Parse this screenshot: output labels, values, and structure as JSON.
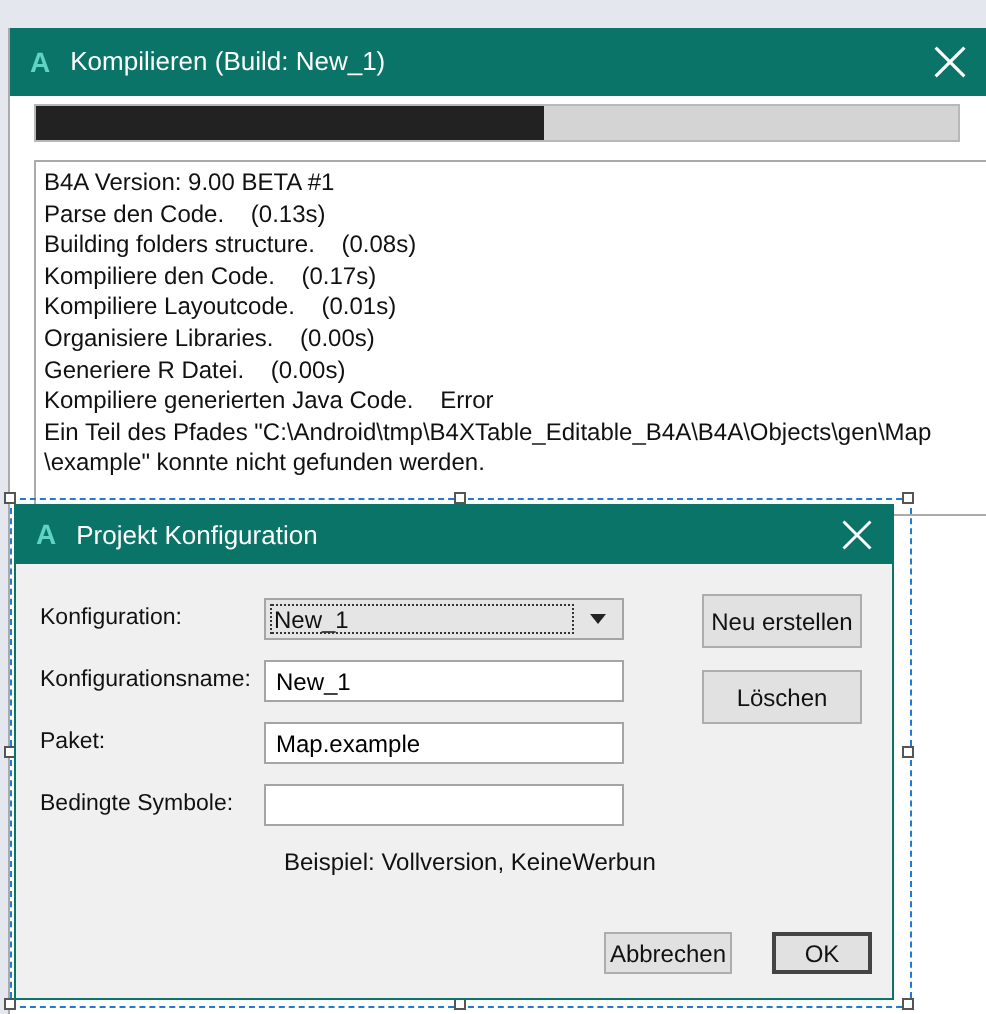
{
  "compile_window": {
    "app_mark": "A",
    "title": "Kompilieren (Build: New_1)",
    "progress": {
      "level": 0.55
    },
    "log": [
      "B4A Version: 9.00 BETA #1",
      "Parse den Code.    (0.13s)",
      "Building folders structure.    (0.08s)",
      "Kompiliere den Code.    (0.17s)",
      "Kompiliere Layoutcode.    (0.01s)",
      "Organisiere Libraries.    (0.00s)",
      "Generiere R Datei.    (0.00s)",
      "Kompiliere generierten Java Code.    Error",
      "Ein Teil des Pfades \"C:\\Android\\tmp\\B4XTable_Editable_B4A\\B4A\\Objects\\gen\\Map",
      "\\example\" konnte nicht gefunden werden."
    ]
  },
  "config_dialog": {
    "app_mark": "A",
    "title": "Projekt Konfiguration",
    "selected": true,
    "fields": [
      {
        "label": "Konfiguration:",
        "kind": "dropdown",
        "value": "New_1",
        "focused": true
      },
      {
        "label": "Konfigurationsname:",
        "kind": "text",
        "value": "New_1"
      },
      {
        "label": "Paket:",
        "kind": "text",
        "value": "Map.example"
      },
      {
        "label": "Bedingte Symbole:",
        "kind": "text"
      }
    ],
    "hint": "Beispiel: Vollversion, KeineWerbun",
    "side_buttons": [
      "Neu erstellen",
      "Löschen"
    ],
    "buttons": [
      {
        "label": "Abbrechen",
        "default": false
      },
      {
        "label": "OK",
        "default": true
      }
    ]
  }
}
